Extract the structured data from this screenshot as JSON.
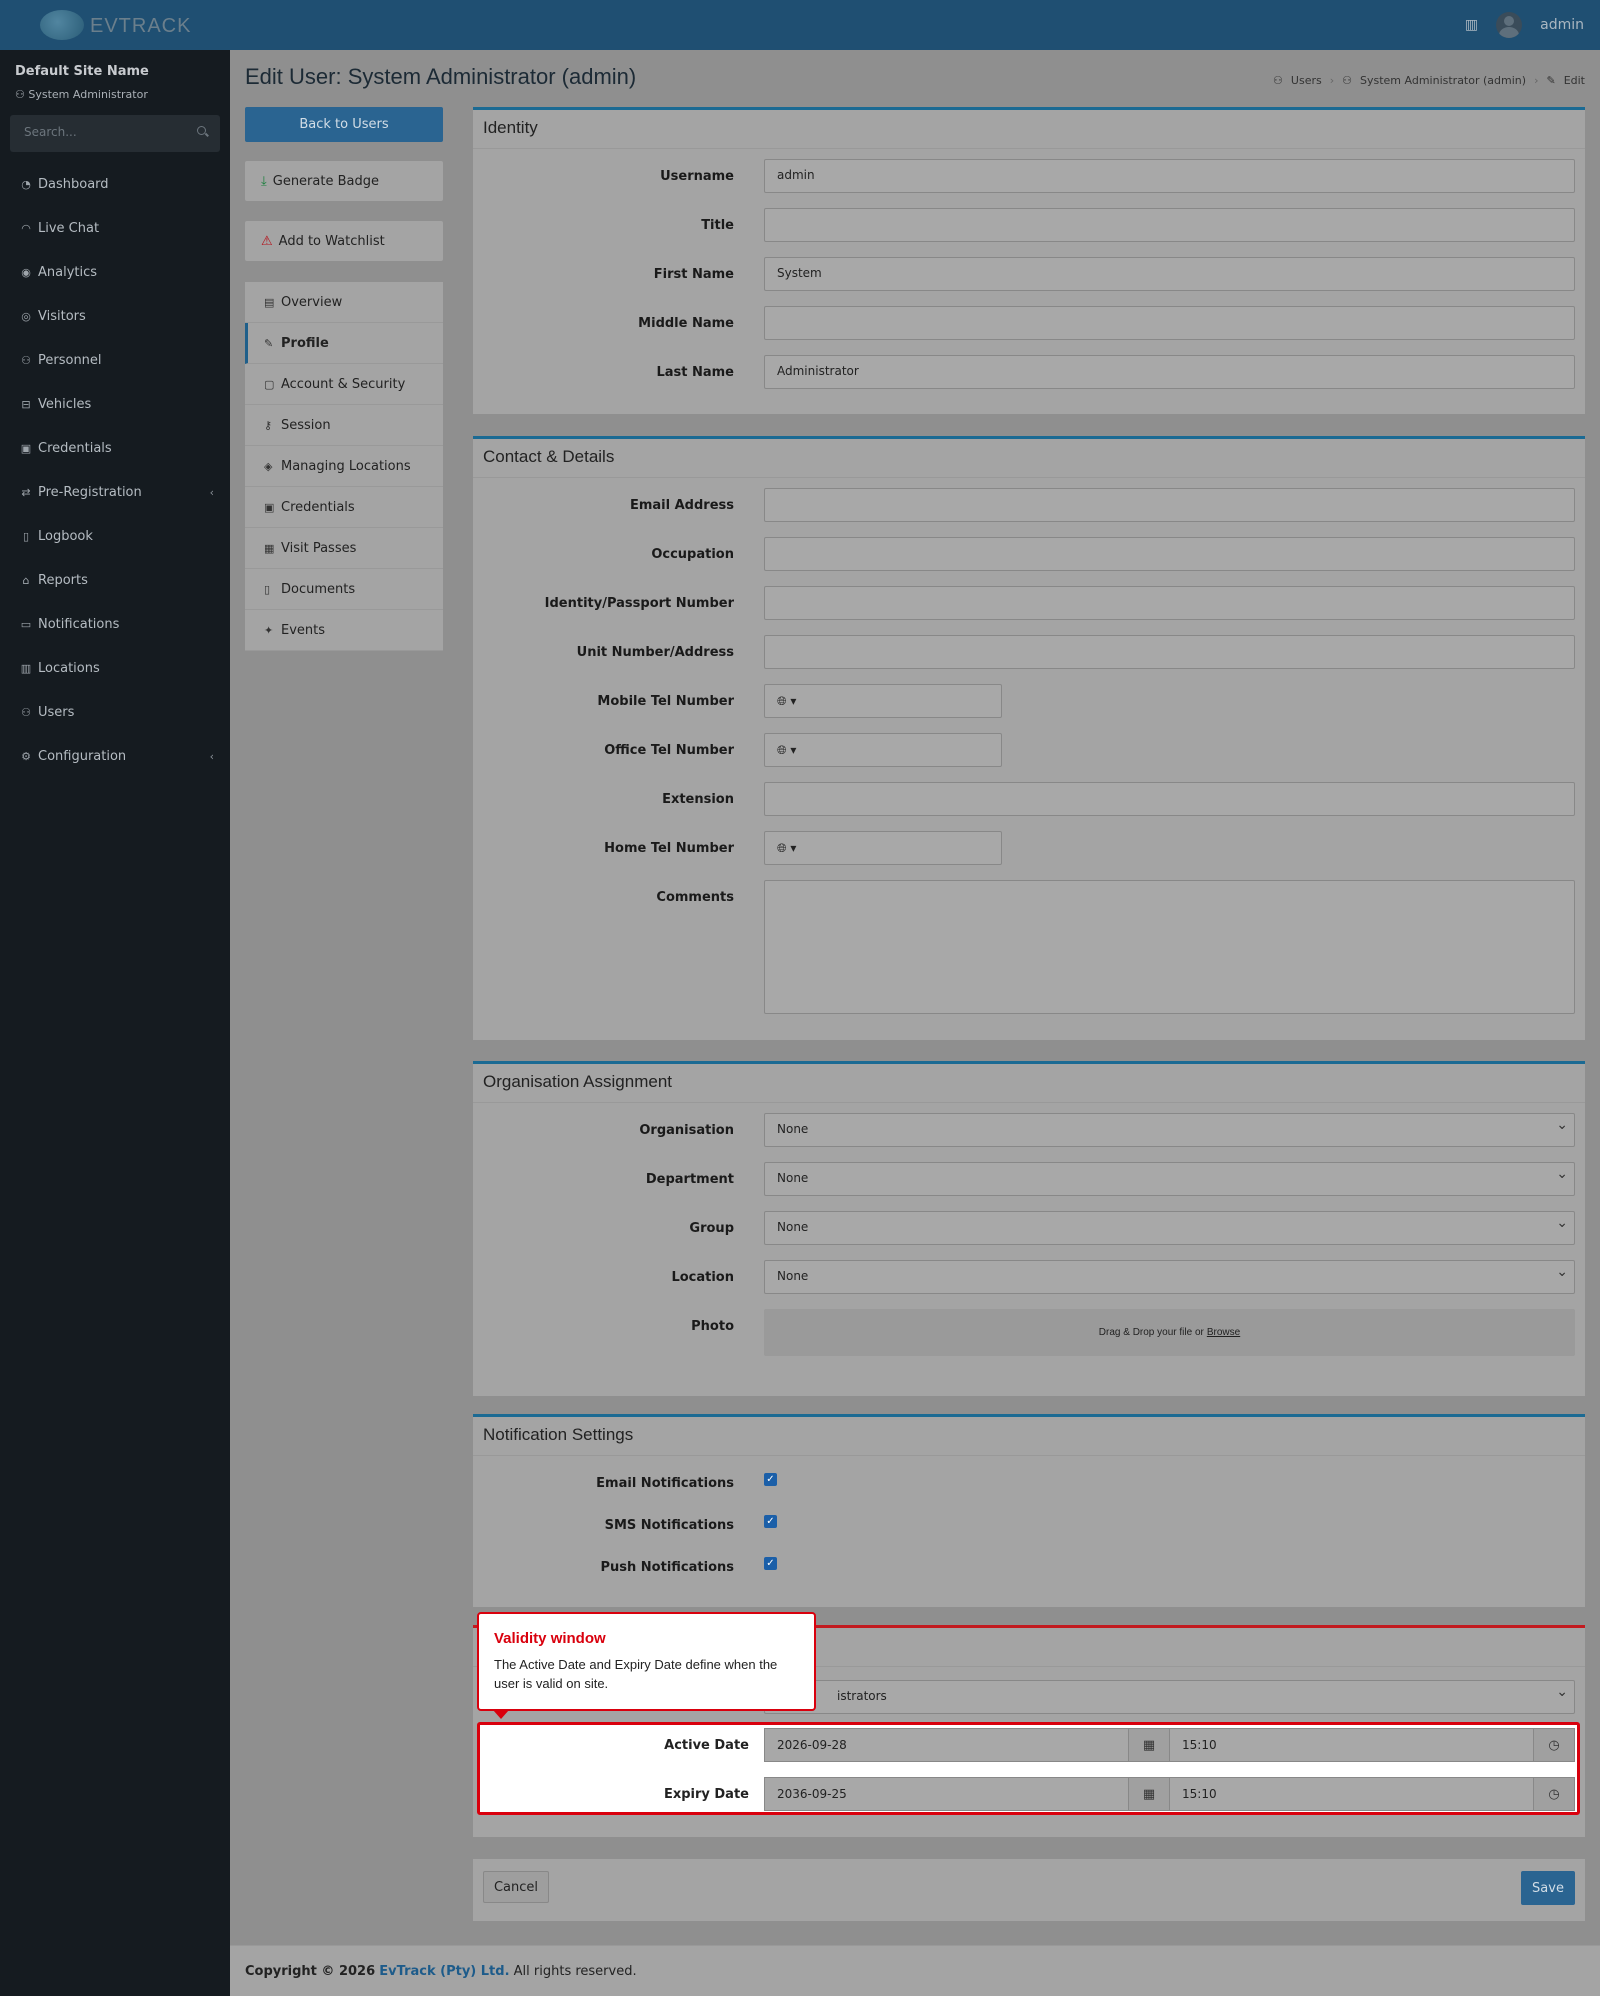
{
  "topbar": {
    "logo_text": "EVTRACK",
    "user": "admin"
  },
  "sidebar": {
    "site_name": "Default Site Name",
    "site_user": "System Administrator",
    "search_placeholder": "Search...",
    "items": [
      {
        "label": "Dashboard",
        "icon": "gauge-icon"
      },
      {
        "label": "Live Chat",
        "icon": "headset-icon"
      },
      {
        "label": "Analytics",
        "icon": "target-icon"
      },
      {
        "label": "Visitors",
        "icon": "eye-icon"
      },
      {
        "label": "Personnel",
        "icon": "personnel-icon"
      },
      {
        "label": "Vehicles",
        "icon": "car-icon"
      },
      {
        "label": "Credentials",
        "icon": "id-card-icon"
      },
      {
        "label": "Pre-Registration",
        "icon": "arrows-icon"
      },
      {
        "label": "Logbook",
        "icon": "book-icon"
      },
      {
        "label": "Reports",
        "icon": "chart-icon"
      },
      {
        "label": "Notifications",
        "icon": "bell-icon"
      },
      {
        "label": "Locations",
        "icon": "building-icon"
      },
      {
        "label": "Users",
        "icon": "users-icon"
      },
      {
        "label": "Configuration",
        "icon": "gear-icon"
      }
    ]
  },
  "page": {
    "title": "Edit User: System Administrator (admin)",
    "breadcrumb": [
      "Users",
      "System Administrator (admin)",
      "Edit"
    ]
  },
  "left": {
    "back": "Back to Users",
    "generate_badge": "Generate Badge",
    "add_watchlist": "Add to Watchlist",
    "tabs": [
      "Overview",
      "Profile",
      "Account & Security",
      "Session",
      "Managing Locations",
      "Credentials",
      "Visit Passes",
      "Documents",
      "Events"
    ]
  },
  "identity": {
    "heading": "Identity",
    "fields": [
      {
        "label": "Username",
        "value": "admin"
      },
      {
        "label": "Title",
        "value": ""
      },
      {
        "label": "First Name",
        "value": "System"
      },
      {
        "label": "Middle Name",
        "value": ""
      },
      {
        "label": "Last Name",
        "value": "Administrator"
      }
    ]
  },
  "contact": {
    "heading": "Contact & Details",
    "email": "Email Address",
    "occupation": "Occupation",
    "idnum": "Identity/Passport Number",
    "unit": "Unit Number/Address",
    "mobile": "Mobile Tel Number",
    "office": "Office Tel Number",
    "extension": "Extension",
    "home": "Home Tel Number",
    "comments": "Comments"
  },
  "org": {
    "heading": "Organisation Assignment",
    "fields": [
      {
        "label": "Organisation",
        "value": "None"
      },
      {
        "label": "Department",
        "value": "None"
      },
      {
        "label": "Group",
        "value": "None"
      },
      {
        "label": "Location",
        "value": "None"
      }
    ],
    "photo_label": "Photo",
    "dropzone": "Drag & Drop your file or",
    "browse": "Browse"
  },
  "notif": {
    "heading": "Notification Settings",
    "items": [
      "Email Notifications",
      "SMS Notifications",
      "Push Notifications"
    ]
  },
  "validity": {
    "role_partial": "istrators",
    "active_label": "Active Date",
    "active_date": "2026-09-28",
    "active_time": "15:10",
    "expiry_label": "Expiry Date",
    "expiry_date": "2036-09-25",
    "expiry_time": "15:10"
  },
  "tooltip": {
    "title": "Validity window",
    "body": "The Active Date and Expiry Date define when the user is valid on site."
  },
  "form_actions": {
    "cancel": "Cancel",
    "save": "Save"
  },
  "footer": {
    "prefix": "Copyright © 2026",
    "company": "EvTrack (Pty) Ltd.",
    "suffix": "All rights reserved."
  }
}
